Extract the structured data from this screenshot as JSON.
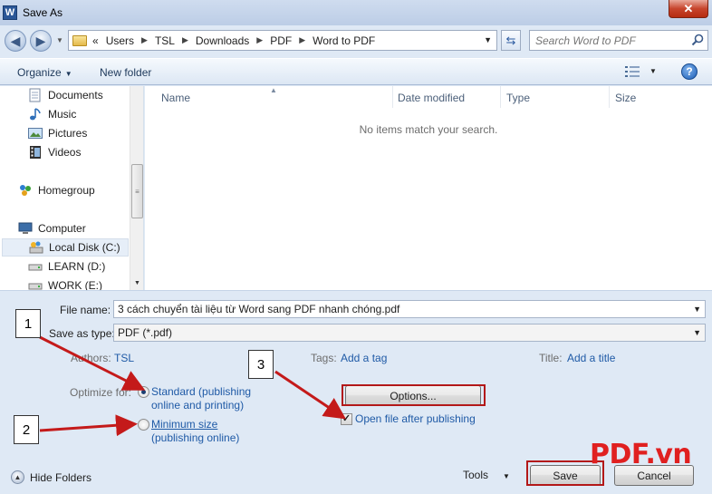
{
  "window": {
    "title": "Save As",
    "app_icon_letter": "W",
    "close_glyph": "✕"
  },
  "address": {
    "overflow": "«",
    "crumbs": [
      "Users",
      "TSL",
      "Downloads",
      "PDF",
      "Word to PDF"
    ],
    "search_placeholder": "Search Word to PDF"
  },
  "toolbar": {
    "organize_label": "Organize",
    "new_folder_label": "New folder",
    "views_icon": "view-list-icon",
    "help_glyph": "?"
  },
  "nav": {
    "items": [
      {
        "label": "Documents",
        "icon": "documents-icon"
      },
      {
        "label": "Music",
        "icon": "music-icon"
      },
      {
        "label": "Pictures",
        "icon": "pictures-icon"
      },
      {
        "label": "Videos",
        "icon": "videos-icon"
      },
      {
        "label": "Homegroup",
        "icon": "homegroup-icon"
      },
      {
        "label": "Computer",
        "icon": "computer-icon"
      },
      {
        "label": "Local Disk (C:)",
        "icon": "drive-icon",
        "selected": true
      },
      {
        "label": "LEARN (D:)",
        "icon": "drive-icon"
      },
      {
        "label": "WORK (E:)",
        "icon": "drive-icon"
      }
    ]
  },
  "filelist": {
    "columns": [
      "Name",
      "Date modified",
      "Type",
      "Size"
    ],
    "empty_message": "No items match your search."
  },
  "form": {
    "file_name_label": "File name:",
    "file_name_value": "3 cách chuyển tài liệu từ Word sang PDF nhanh chóng.pdf",
    "save_type_label": "Save as type:",
    "save_type_value": "PDF (*.pdf)",
    "authors_label": "Authors:",
    "authors_value": "TSL",
    "tags_label": "Tags:",
    "tags_value": "Add a tag",
    "title_label": "Title:",
    "title_value": "Add a title",
    "optimize_label": "Optimize for:",
    "standard_line1": "Standard (publishing",
    "standard_line2": "online and printing)",
    "minimum_line1": "Minimum size",
    "minimum_line2": "(publishing online)",
    "optimize_selected": "standard",
    "options_label": "Options...",
    "open_after_label": "Open file after publishing",
    "open_after_checked": true,
    "hide_folders_label": "Hide Folders",
    "tools_label": "Tools",
    "save_label": "Save",
    "cancel_label": "Cancel"
  },
  "annotations": {
    "callouts": [
      "1",
      "2",
      "3"
    ],
    "watermark": "PDF.vn",
    "highlight_color": "#b31818"
  }
}
